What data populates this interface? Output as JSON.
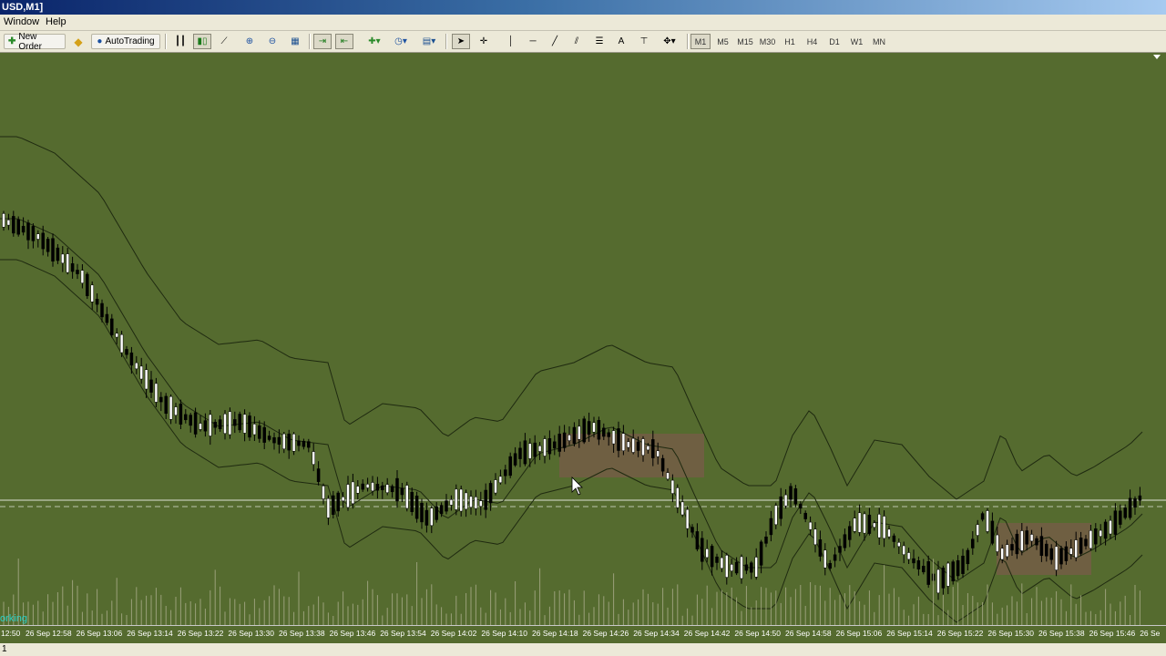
{
  "window": {
    "title": "USD,M1]"
  },
  "menu": {
    "items": [
      {
        "label": "Window"
      },
      {
        "label": "Help"
      }
    ]
  },
  "toolbar": {
    "new_order_label": "New Order",
    "autotrading_label": "AutoTrading",
    "text_tool_label": "A",
    "timeframes": [
      "M1",
      "M5",
      "M15",
      "M30",
      "H1",
      "H4",
      "D1",
      "W1",
      "MN"
    ],
    "active_timeframe": "M1"
  },
  "chart": {
    "background": "#556b2f",
    "up_candle_color": "#ffffff",
    "down_candle_color": "#000000",
    "band_color": "#1f2a10",
    "highlight_color": "#7a5a4a",
    "bid_line_color": "#ffffff",
    "time_labels": [
      "12:50",
      "26 Sep 12:58",
      "26 Sep 13:06",
      "26 Sep 13:14",
      "26 Sep 13:22",
      "26 Sep 13:30",
      "26 Sep 13:38",
      "26 Sep 13:46",
      "26 Sep 13:54",
      "26 Sep 14:02",
      "26 Sep 14:10",
      "26 Sep 14:18",
      "26 Sep 14:26",
      "26 Sep 14:34",
      "26 Sep 14:42",
      "26 Sep 14:50",
      "26 Sep 14:58",
      "26 Sep 15:06",
      "26 Sep 15:14",
      "26 Sep 15:22",
      "26 Sep 15:30",
      "26 Sep 15:38",
      "26 Sep 15:46",
      "26 Se"
    ],
    "watermark": "orking"
  },
  "status": {
    "text": "1"
  }
}
